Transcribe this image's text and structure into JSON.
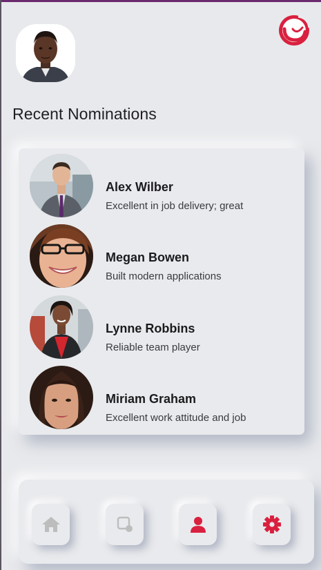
{
  "section_title": "Recent Nominations",
  "colors": {
    "accent": "#d9203f",
    "icon_inactive": "#bdbdbd",
    "top_bar": "#6b2a6e"
  },
  "nominations": [
    {
      "name": "Alex Wilber",
      "reason": "Excellent in job delivery; great"
    },
    {
      "name": "Megan Bowen",
      "reason": "Built modern applications"
    },
    {
      "name": "Lynne Robbins",
      "reason": "Reliable team player"
    },
    {
      "name": "Miriam Graham",
      "reason": "Excellent work attitude and job"
    }
  ],
  "nav": [
    {
      "icon": "home-icon",
      "active": false
    },
    {
      "icon": "nominate-icon",
      "active": false
    },
    {
      "icon": "person-icon",
      "active": true
    },
    {
      "icon": "gear-icon",
      "active": true
    }
  ]
}
